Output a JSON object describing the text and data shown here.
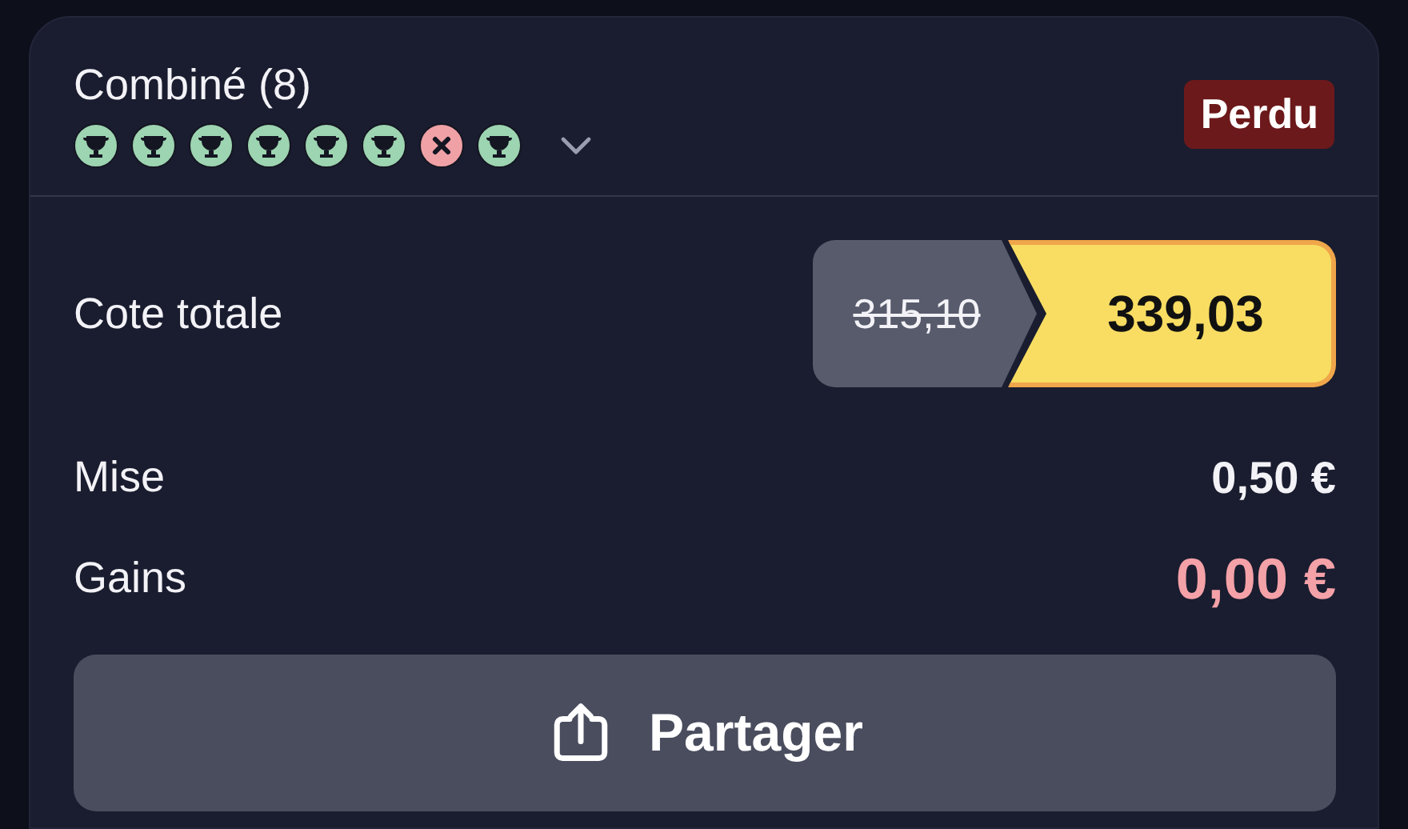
{
  "bet": {
    "title": "Combiné (8)",
    "expanded": false,
    "status": "Perdu",
    "legs": [
      {
        "kind": "won"
      },
      {
        "kind": "won"
      },
      {
        "kind": "won"
      },
      {
        "kind": "won"
      },
      {
        "kind": "won"
      },
      {
        "kind": "won"
      },
      {
        "kind": "lost"
      },
      {
        "kind": "won"
      }
    ]
  },
  "odds": {
    "label": "Cote totale",
    "old": "315,10",
    "boosted": "339,03"
  },
  "rows": [
    {
      "kind": "stake",
      "label": "Mise",
      "value": "0,50 €"
    },
    {
      "kind": "winnings",
      "label": "Gains",
      "value": "0,00 €"
    }
  ],
  "share_button": "Partager"
}
